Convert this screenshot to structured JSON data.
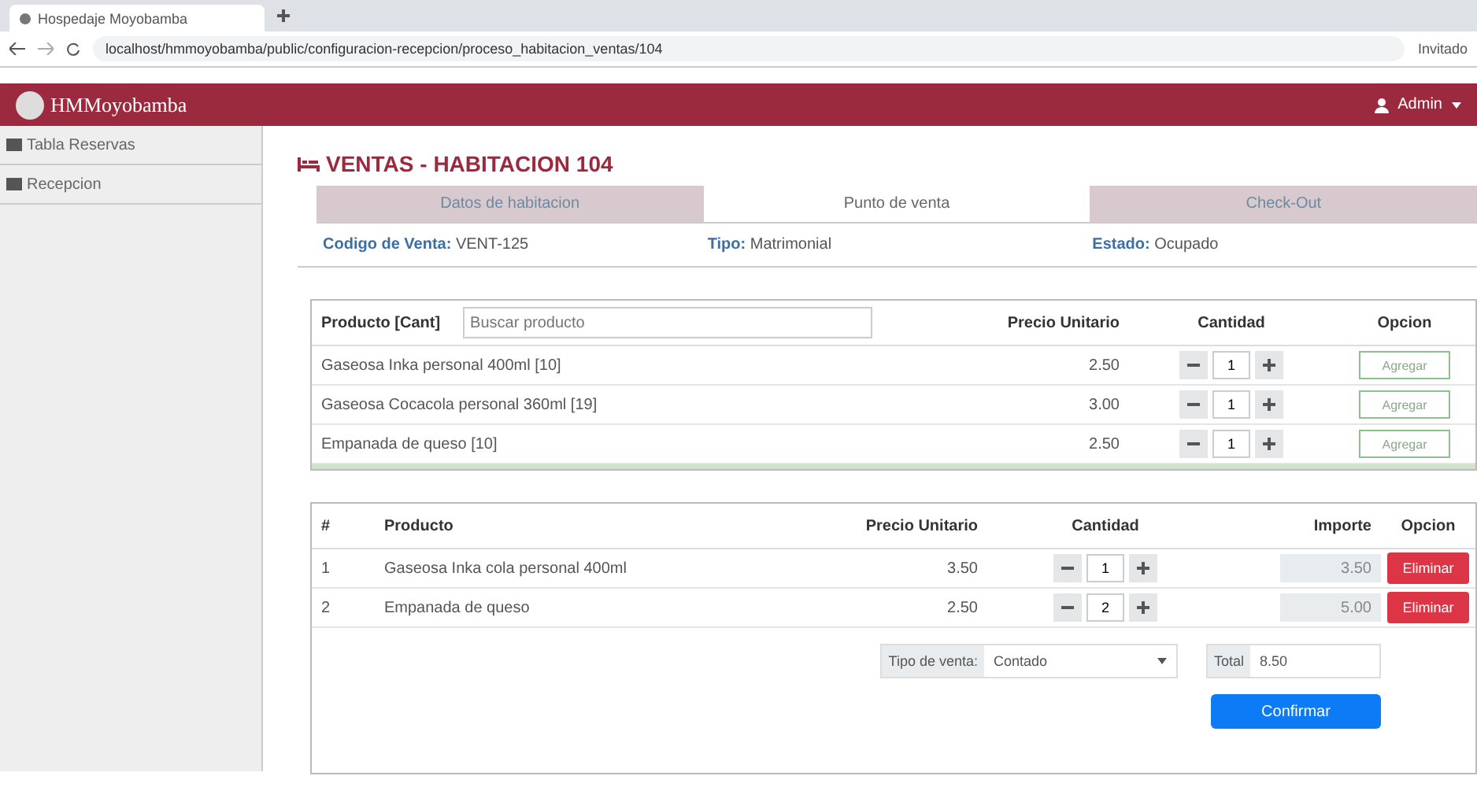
{
  "browser": {
    "tab_title": "Hospedaje Moyobamba",
    "url": "localhost/hmmoyobamba/public/configuracion-recepcion/proceso_habitacion_ventas/104",
    "profile": "Invitado"
  },
  "navbar": {
    "brand": "HMMoyobamba",
    "user": "Admin"
  },
  "sidebar": {
    "items": [
      {
        "label": "Tabla Reservas",
        "selected": false
      },
      {
        "label": "Recepcion",
        "selected": false
      }
    ]
  },
  "page_title": "VENTAS - HABITACION 104",
  "tabs": [
    {
      "label": "Datos de habitacion",
      "selected": false
    },
    {
      "label": "Punto de venta",
      "selected": true
    },
    {
      "label": "Check-Out",
      "selected": false
    }
  ],
  "info": [
    {
      "label": "Codigo de Venta:",
      "value": "VENT-125"
    },
    {
      "label": "Tipo:",
      "value": "Matrimonial"
    },
    {
      "label": "Estado:",
      "value": "Ocupado"
    }
  ],
  "catalog": {
    "columns": [
      "Producto [Cant]",
      "Precio Unitario",
      "Cantidad",
      "Opcion"
    ],
    "search_placeholder": "Buscar producto",
    "rows": [
      {
        "product": "Gaseosa Inka personal 400ml [10]",
        "price": "2.50",
        "qty": "1",
        "action": "Agregar"
      },
      {
        "product": "Gaseosa Cocacola personal 360ml [19]",
        "price": "3.00",
        "qty": "1",
        "action": "Agregar"
      },
      {
        "product": "Empanada de queso [10]",
        "price": "2.50",
        "qty": "1",
        "action": "Agregar"
      }
    ]
  },
  "cart": {
    "columns": [
      "#",
      "Producto",
      "Precio Unitario",
      "Cantidad",
      "Importe",
      "Opcion"
    ],
    "rows": [
      {
        "index": "1",
        "product": "Gaseosa Inka cola personal 400ml",
        "price": "3.50",
        "qty": "1",
        "amount": "3.50",
        "action": "Eliminar"
      },
      {
        "index": "2",
        "product": "Empanada de queso",
        "price": "2.50",
        "qty": "2",
        "amount": "5.00",
        "action": "Eliminar"
      }
    ],
    "sale_type_label": "Tipo de venta:",
    "sale_type": "Contado",
    "total_label": "Total",
    "total": "8.50",
    "confirm": "Confirmar"
  }
}
